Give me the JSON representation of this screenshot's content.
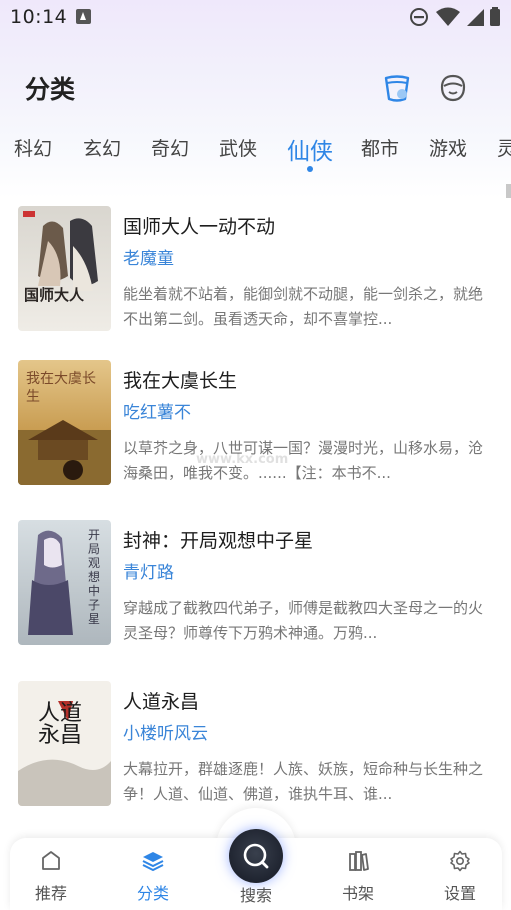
{
  "status_bar": {
    "time": "10:14"
  },
  "header": {
    "title": "分类"
  },
  "tabs": [
    {
      "label": "科幻"
    },
    {
      "label": "玄幻"
    },
    {
      "label": "奇幻"
    },
    {
      "label": "武侠"
    },
    {
      "label": "仙侠",
      "active": true
    },
    {
      "label": "都市"
    },
    {
      "label": "游戏"
    },
    {
      "label": "灵"
    }
  ],
  "books": [
    {
      "title": "国师大人一动不动",
      "author": "老魔童",
      "description": "能坐着就不站着，能御剑就不动腿，能一剑杀之，就绝不出第二剑。虽看透天命，却不喜掌控...",
      "cover_text": "国师大人"
    },
    {
      "title": "我在大虞长生",
      "author": "吃红薯不",
      "description": "以草芥之身，八世可谋一国？漫漫时光，山移水易，沧海桑田，唯我不变。......【注：本书不...",
      "cover_text": "我在大虞长生"
    },
    {
      "title": "封神：开局观想中子星",
      "author": "青灯路",
      "description": "穿越成了截教四代弟子，师傅是截教四大圣母之一的火灵圣母？师尊传下万鸦术神通。万鸦...",
      "cover_text": "开局观想中子星"
    },
    {
      "title": "人道永昌",
      "author": "小楼听风云",
      "description": "大幕拉开，群雄逐鹿！人族、妖族，短命种与长生种之争！人道、仙道、佛道，谁执牛耳、谁...",
      "cover_text": "人道永昌"
    }
  ],
  "watermark": "www.kx.com",
  "bottom_nav": [
    {
      "label": "推荐",
      "icon": "home-icon"
    },
    {
      "label": "分类",
      "icon": "layers-icon",
      "active": true
    },
    {
      "label": "搜索",
      "icon": "search-icon"
    },
    {
      "label": "书架",
      "icon": "bookshelf-icon"
    },
    {
      "label": "设置",
      "icon": "gear-icon"
    }
  ],
  "colors": {
    "accent": "#2f86e6",
    "author": "#3a85d8"
  }
}
